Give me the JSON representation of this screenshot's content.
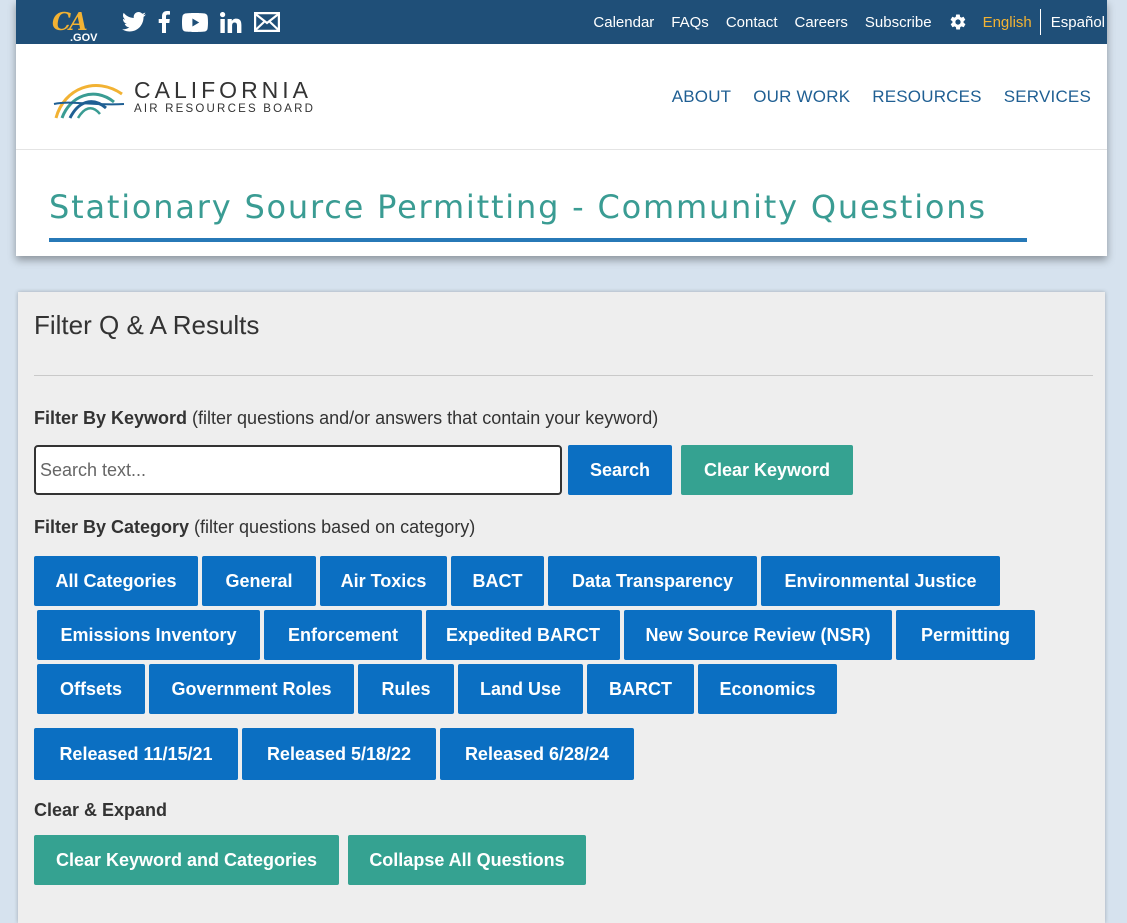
{
  "topbar": {
    "logo_text": "CA",
    "logo_suffix": ".GOV",
    "social_icons": [
      "twitter-icon",
      "facebook-icon",
      "youtube-icon",
      "linkedin-icon",
      "email-icon"
    ],
    "links": [
      "Calendar",
      "FAQs",
      "Contact",
      "Careers",
      "Subscribe"
    ],
    "settings_icon": "gear-icon",
    "lang_active": "English",
    "lang_other": "Español"
  },
  "header": {
    "logo_main": "CALIFORNIA",
    "logo_sub": "AIR RESOURCES BOARD",
    "nav": [
      "ABOUT",
      "OUR WORK",
      "RESOURCES",
      "SERVICES"
    ]
  },
  "page": {
    "title": "Stationary Source Permitting - Community Questions"
  },
  "filter": {
    "title": "Filter Q & A Results",
    "keyword_label": "Filter By Keyword",
    "keyword_hint": " (filter questions and/or answers that contain your keyword)",
    "search_placeholder": "Search text...",
    "search_value": "",
    "search_button": "Search",
    "clear_keyword_button": "Clear Keyword",
    "category_label": "Filter By Category",
    "category_hint": " (filter questions based on category)",
    "category_rows": [
      [
        "All Categories",
        "General",
        "Air Toxics",
        "BACT",
        "Data Transparency",
        "Environmental Justice"
      ],
      [
        "Emissions Inventory",
        "Enforcement",
        "Expedited BARCT",
        "New Source Review (NSR)",
        "Permitting"
      ],
      [
        "Offsets",
        "Government Roles",
        "Rules",
        "Land Use",
        "BARCT",
        "Economics"
      ]
    ],
    "release_buttons": [
      "Released 11/15/21",
      "Released 5/18/22",
      "Released 6/28/24"
    ],
    "clear_expand_label": "Clear & Expand",
    "clear_all_button": "Clear Keyword and Categories",
    "collapse_button": "Collapse All Questions"
  },
  "colors": {
    "topbar": "#1f4f78",
    "accent_gold": "#f2b233",
    "title_teal": "#3a9c93",
    "rule_blue": "#2779b7",
    "button_blue": "#0b6fc2",
    "button_green": "#35a291",
    "nav_blue": "#1f5f93"
  }
}
